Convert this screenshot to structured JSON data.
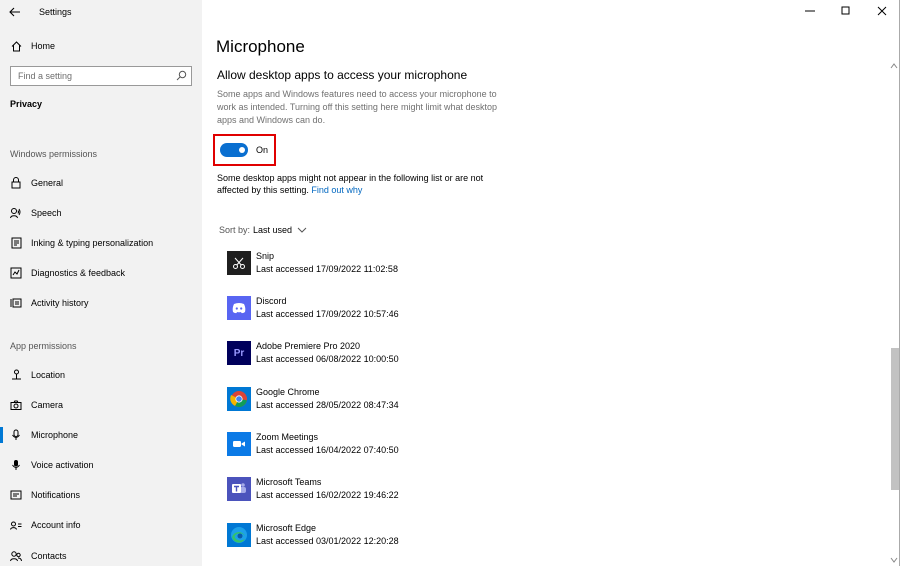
{
  "window": {
    "title": "Settings"
  },
  "sidebar": {
    "home_label": "Home",
    "search_placeholder": "Find a setting",
    "category": "Privacy",
    "windows_permissions_header": "Windows permissions",
    "windows_items": [
      {
        "label": "General",
        "icon": "lock-icon"
      },
      {
        "label": "Speech",
        "icon": "speech-icon"
      },
      {
        "label": "Inking & typing personalization",
        "icon": "inking-icon"
      },
      {
        "label": "Diagnostics & feedback",
        "icon": "diagnostics-icon"
      },
      {
        "label": "Activity history",
        "icon": "activity-icon"
      }
    ],
    "app_permissions_header": "App permissions",
    "app_items": [
      {
        "label": "Location",
        "icon": "location-icon"
      },
      {
        "label": "Camera",
        "icon": "camera-icon"
      },
      {
        "label": "Microphone",
        "icon": "microphone-icon",
        "active": true
      },
      {
        "label": "Voice activation",
        "icon": "voice-activation-icon"
      },
      {
        "label": "Notifications",
        "icon": "notifications-icon"
      },
      {
        "label": "Account info",
        "icon": "account-info-icon"
      },
      {
        "label": "Contacts",
        "icon": "contacts-icon"
      }
    ]
  },
  "main": {
    "page_title": "Microphone",
    "section_title": "Allow desktop apps to access your microphone",
    "description": "Some apps and Windows features need to access your microphone to work as intended. Turning off this setting here might limit what desktop apps and Windows can do.",
    "toggle": {
      "state": "On",
      "on": true
    },
    "note_text": "Some desktop apps might not appear in the following list or are not affected by this setting.",
    "note_link": "Find out why",
    "sort_label": "Sort by:",
    "sort_value": "Last used",
    "apps": [
      {
        "name": "Snip",
        "last_accessed": "Last accessed 17/09/2022 11:02:58",
        "icon": "snip-icon"
      },
      {
        "name": "Discord",
        "last_accessed": "Last accessed 17/09/2022 10:57:46",
        "icon": "discord-icon"
      },
      {
        "name": "Adobe Premiere Pro 2020",
        "last_accessed": "Last accessed 06/08/2022 10:00:50",
        "icon": "premiere-icon"
      },
      {
        "name": "Google Chrome",
        "last_accessed": "Last accessed 28/05/2022 08:47:34",
        "icon": "chrome-icon"
      },
      {
        "name": "Zoom Meetings",
        "last_accessed": "Last accessed 16/04/2022 07:40:50",
        "icon": "zoom-icon"
      },
      {
        "name": "Microsoft Teams",
        "last_accessed": "Last accessed 16/02/2022 19:46:22",
        "icon": "teams-icon"
      },
      {
        "name": "Microsoft Edge",
        "last_accessed": "Last accessed 03/01/2022 12:20:28",
        "icon": "edge-icon"
      }
    ]
  },
  "colors": {
    "accent": "#0078d4",
    "toggle_on": "#0a6fd0",
    "highlight_box": "#e00000",
    "sidebar_bg": "#f2f2f2"
  }
}
